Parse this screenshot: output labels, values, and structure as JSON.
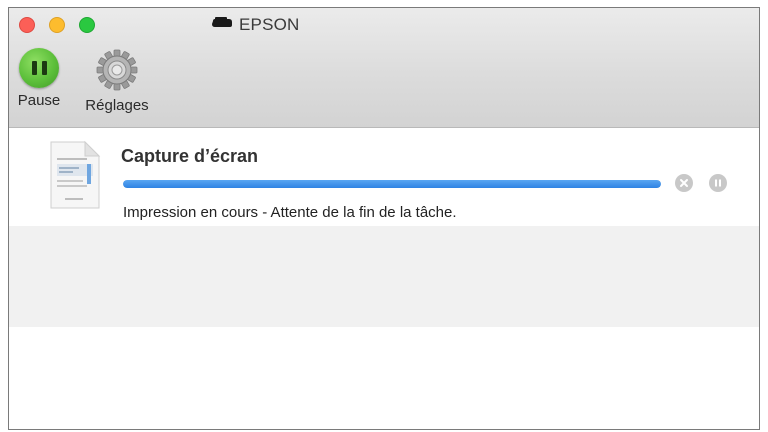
{
  "window": {
    "title": "EPSON",
    "title_icon": "printer-icon"
  },
  "toolbar": {
    "pause_label": "Pause",
    "settings_label": "Réglages",
    "pause_icon": "pause-icon",
    "settings_icon": "gear-icon"
  },
  "job": {
    "name": "Capture d’écran",
    "status": "Impression en cours - Attente de la fin de la tâche.",
    "progress": 1.0,
    "progress_color": "#3a8ee6"
  },
  "colors": {
    "close": "#fc5f57",
    "minimize": "#fdbc2e",
    "maximize": "#2ac840",
    "pause_button": "#5cbf3a"
  }
}
